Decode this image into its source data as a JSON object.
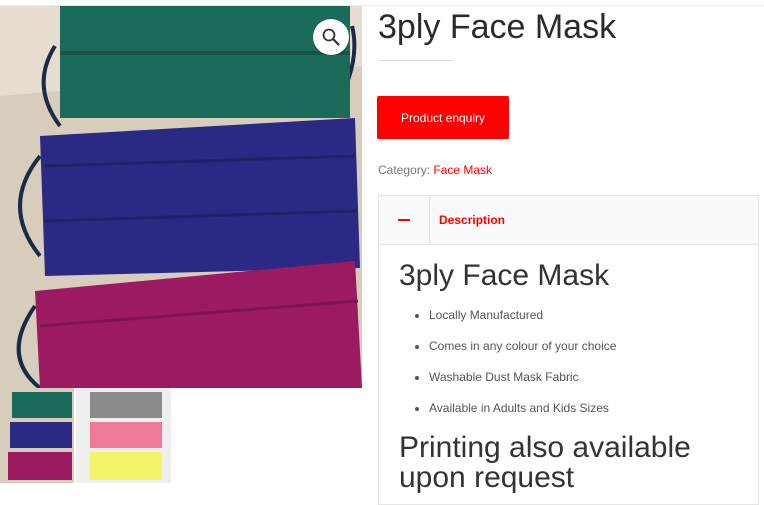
{
  "product": {
    "title": "3ply Face Mask",
    "enquiry_label": "Product enquiry",
    "category_prefix": "Category:",
    "category": "Face Mask"
  },
  "gallery": {
    "zoom_icon": "magnifier-icon",
    "main_image_alt": "",
    "main_mask_colors": [
      "#1a6b5a",
      "#2a2a84",
      "#9c1a62"
    ],
    "thumb2_mask_colors": [
      "#8a8a8a",
      "#f07a9a",
      "#f3f36a"
    ]
  },
  "tabs": {
    "toggle_icon": "minus-icon",
    "description_label": "Description"
  },
  "description": {
    "heading": "3ply Face Mask",
    "features": [
      "Locally Manufactured",
      "Comes in any colour of your choice",
      "Washable Dust Mask Fabric",
      "Available in Adults and Kids Sizes"
    ],
    "subheading": "Printing also available upon request"
  },
  "colors": {
    "accent": "#ff0000"
  }
}
